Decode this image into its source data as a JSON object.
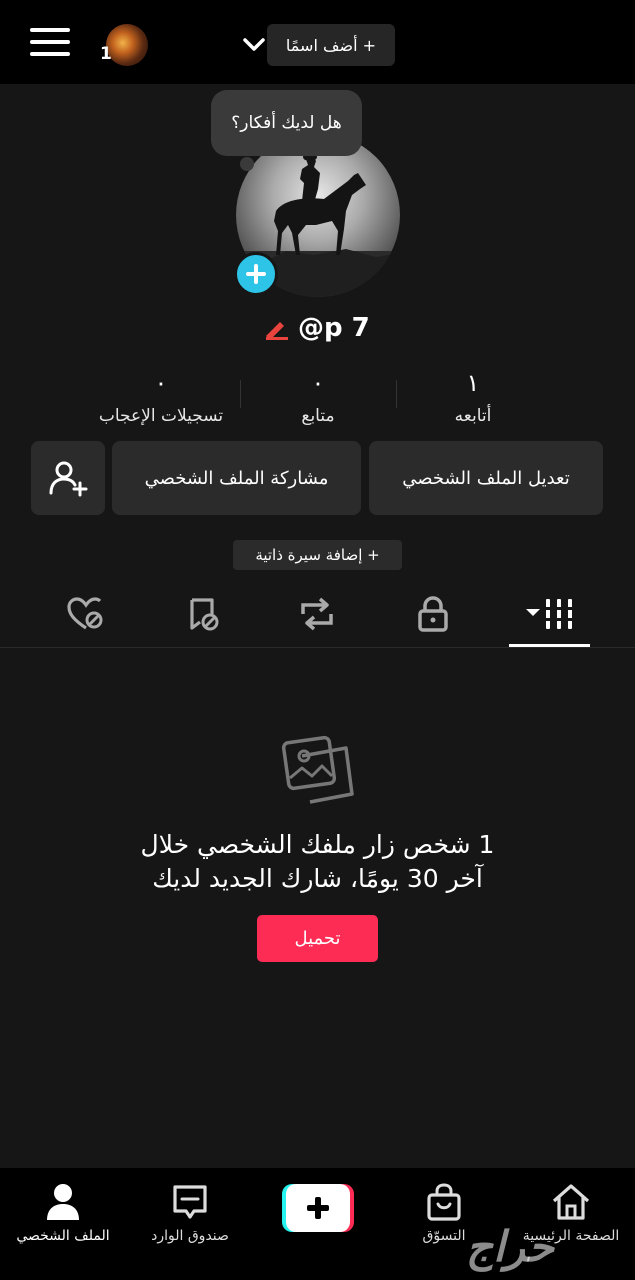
{
  "header": {
    "notification_count": "1",
    "add_name_label": "+ أضف اسمًا"
  },
  "profile": {
    "thought_bubble": "هل لديك أفكار؟",
    "username": "@p 7"
  },
  "stats": [
    {
      "value": "١",
      "label": "أتابعه"
    },
    {
      "value": "٠",
      "label": "متابع"
    },
    {
      "value": "٠",
      "label": "تسجيلات الإعجاب"
    }
  ],
  "actions": {
    "edit_profile": "تعديل الملف الشخصي",
    "share_profile": "مشاركة الملف الشخصي",
    "add_bio": "+ إضافة سيرة ذاتية"
  },
  "tabs": [
    "videos-grid-icon",
    "lock-icon",
    "repost-icon",
    "favorites-icon",
    "liked-icon"
  ],
  "empty_state": {
    "line1": "1 شخص زار ملفك الشخصي خلال",
    "line2": "آخر 30 يومًا، شارك الجديد لديك",
    "upload_label": "تحميل"
  },
  "bottom_nav": {
    "home": "الصفحة الرئيسية",
    "shop": "التسوّق",
    "inbox": "صندوق الوارد",
    "profile": "الملف الشخصي"
  },
  "watermark": "حراج",
  "colors": {
    "accent": "#fd2c55",
    "add_photo": "#2ec4e8",
    "background": "#161616"
  }
}
